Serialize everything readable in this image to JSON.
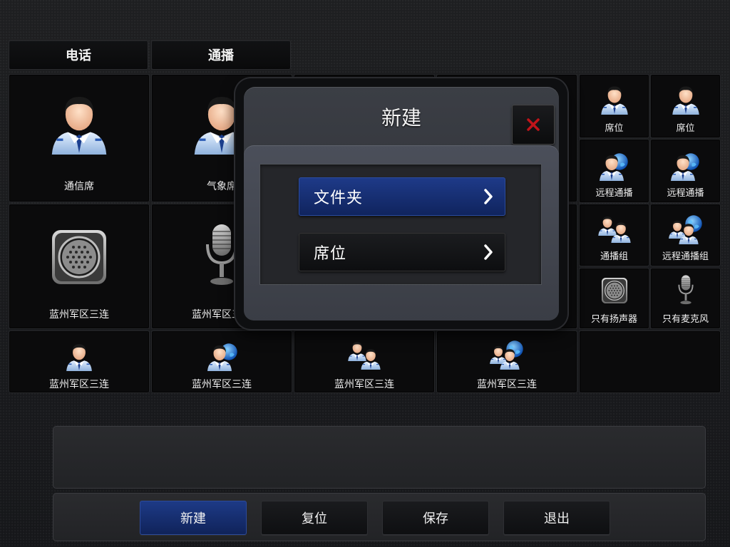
{
  "tabs": [
    {
      "label": "电话"
    },
    {
      "label": "通播"
    }
  ],
  "tiles": {
    "big": [
      {
        "label": "通信席",
        "icon": "officer-icon"
      },
      {
        "label": "气象席",
        "icon": "officer-icon"
      },
      {
        "label": "蓝州军区三连",
        "icon": "speaker-icon"
      },
      {
        "label": "蓝州军区三连",
        "icon": "microphone-icon"
      }
    ],
    "right": [
      {
        "label": "席位",
        "icon": "officer-icon"
      },
      {
        "label": "席位",
        "icon": "officer-icon"
      },
      {
        "label": "远程通播",
        "icon": "officer-globe-icon"
      },
      {
        "label": "远程通播",
        "icon": "officer-globe-icon"
      },
      {
        "label": "通播组",
        "icon": "officer-group-icon"
      },
      {
        "label": "远程通播组",
        "icon": "officer-group-globe-icon"
      },
      {
        "label": "只有扬声器",
        "icon": "speaker-icon"
      },
      {
        "label": "只有麦克风",
        "icon": "microphone-icon"
      }
    ],
    "bottom": [
      {
        "label": "蓝州军区三连",
        "icon": "officer-icon"
      },
      {
        "label": "蓝州军区三连",
        "icon": "officer-globe-icon"
      },
      {
        "label": "蓝州军区三连",
        "icon": "officer-group-icon"
      },
      {
        "label": "蓝州军区三连",
        "icon": "officer-group-globe-icon"
      }
    ]
  },
  "toolbar": {
    "new_label": "新建",
    "reset_label": "复位",
    "save_label": "保存",
    "exit_label": "退出"
  },
  "modal": {
    "title": "新建",
    "options": [
      {
        "label": "文件夹",
        "selected": true
      },
      {
        "label": "席位",
        "selected": false
      }
    ]
  },
  "colors": {
    "accent_blue": "#1d3a86",
    "close_red": "#c0141a"
  }
}
